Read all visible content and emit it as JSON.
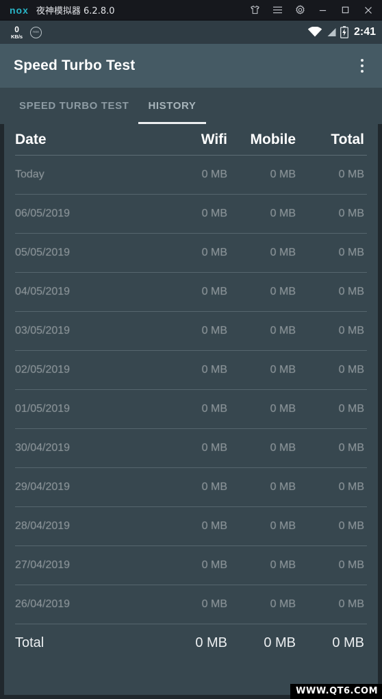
{
  "emulator": {
    "logo": "nox",
    "title": "夜神模拟器 6.2.8.0",
    "window_buttons": [
      {
        "name": "shirt-icon",
        "label": "Theme"
      },
      {
        "name": "menu-icon",
        "label": "Menu"
      },
      {
        "name": "gear-icon",
        "label": "Settings"
      },
      {
        "name": "minimize-icon",
        "label": "Minimize"
      },
      {
        "name": "maximize-icon",
        "label": "Maximize"
      },
      {
        "name": "close-icon",
        "label": "Close"
      }
    ]
  },
  "status_bar": {
    "speed_value": "0",
    "speed_unit": "KB/s",
    "nox_badge": "nox",
    "clock": "2:41",
    "icons": [
      "wifi-icon",
      "signal-icon",
      "battery-charging-icon"
    ]
  },
  "app_bar": {
    "title": "Speed Turbo Test",
    "overflow_label": "More options"
  },
  "tabs": [
    {
      "label": "SPEED TURBO TEST",
      "active": false
    },
    {
      "label": "HISTORY",
      "active": true
    }
  ],
  "table": {
    "headers": [
      "Date",
      "Wifi",
      "Mobile",
      "Total"
    ],
    "rows": [
      {
        "date": "Today",
        "wifi": "0 MB",
        "mobile": "0 MB",
        "total": "0 MB"
      },
      {
        "date": "06/05/2019",
        "wifi": "0 MB",
        "mobile": "0 MB",
        "total": "0 MB"
      },
      {
        "date": "05/05/2019",
        "wifi": "0 MB",
        "mobile": "0 MB",
        "total": "0 MB"
      },
      {
        "date": "04/05/2019",
        "wifi": "0 MB",
        "mobile": "0 MB",
        "total": "0 MB"
      },
      {
        "date": "03/05/2019",
        "wifi": "0 MB",
        "mobile": "0 MB",
        "total": "0 MB"
      },
      {
        "date": "02/05/2019",
        "wifi": "0 MB",
        "mobile": "0 MB",
        "total": "0 MB"
      },
      {
        "date": "01/05/2019",
        "wifi": "0 MB",
        "mobile": "0 MB",
        "total": "0 MB"
      },
      {
        "date": "30/04/2019",
        "wifi": "0 MB",
        "mobile": "0 MB",
        "total": "0 MB"
      },
      {
        "date": "29/04/2019",
        "wifi": "0 MB",
        "mobile": "0 MB",
        "total": "0 MB"
      },
      {
        "date": "28/04/2019",
        "wifi": "0 MB",
        "mobile": "0 MB",
        "total": "0 MB"
      },
      {
        "date": "27/04/2019",
        "wifi": "0 MB",
        "mobile": "0 MB",
        "total": "0 MB"
      },
      {
        "date": "26/04/2019",
        "wifi": "0 MB",
        "mobile": "0 MB",
        "total": "0 MB"
      }
    ],
    "footer": {
      "date": "Total",
      "wifi": "0 MB",
      "mobile": "0 MB",
      "total": "0 MB"
    }
  },
  "watermark": "WWW.QT6.COM",
  "colors": {
    "app_bar": "#455a64",
    "content_bg": "#37474f",
    "status_bar": "#2f3c44",
    "emu_bar": "#16181d",
    "accent": "#29b6c8",
    "tab_indicator": "#eceff1"
  }
}
